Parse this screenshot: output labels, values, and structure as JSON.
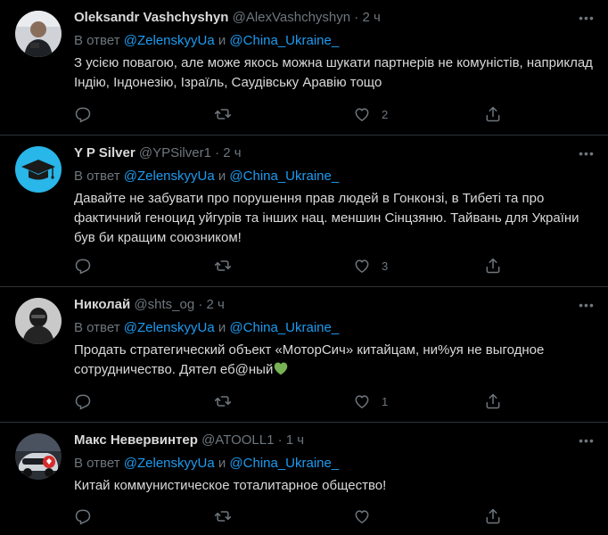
{
  "tweets": [
    {
      "name": "Oleksandr Vashchyshyn",
      "handle": "@AlexVashchyshyn",
      "dot": "·",
      "time": "2 ч",
      "reply_prefix": "В ответ",
      "reply_to_1": "@ZelenskyyUa",
      "reply_and": "и",
      "reply_to_2": "@China_Ukraine_",
      "text": "З усією повагою, але може якось можна шукати партнерів не комуністів, наприклад Індію, Індонезію, Ізраїль, Саудівську Аравію тощо",
      "likes": "2"
    },
    {
      "name": "Y P Silver",
      "handle": "@YPSilver1",
      "dot": "·",
      "time": "2 ч",
      "reply_prefix": "В ответ",
      "reply_to_1": "@ZelenskyyUa",
      "reply_and": "и",
      "reply_to_2": "@China_Ukraine_",
      "text": "Давайте не забувати про порушення прав людей в Гонконзі, в Тибеті та про фактичний геноцид уйгурів та інших нац. меншин Сінцзяню. Тайвань для України був би кращим союзником!",
      "likes": "3"
    },
    {
      "name": "Николай",
      "handle": "@shts_og",
      "dot": "·",
      "time": "2 ч",
      "reply_prefix": "В ответ",
      "reply_to_1": "@ZelenskyyUa",
      "reply_and": "и",
      "reply_to_2": "@China_Ukraine_",
      "text": "Продать стратегический объект «МоторСич» китайцам, ни%уя не выгодное сотрудничество. Дятел еб@ный",
      "likes": "1"
    },
    {
      "name": "Макс Невервинтер",
      "handle": "@ATOOLL1",
      "dot": "·",
      "time": "1 ч",
      "reply_prefix": "В ответ",
      "reply_to_1": "@ZelenskyyUa",
      "reply_and": "и",
      "reply_to_2": "@China_Ukraine_",
      "text": "Китай коммунистическое тоталитарное общество!",
      "likes": ""
    }
  ],
  "colors": {
    "background": "#000000",
    "link": "#1d9bf0",
    "muted": "#6e767d",
    "text": "#d9d9d9",
    "divider": "#2f3336",
    "green_heart": "#77b255"
  },
  "icons": {
    "reply": "reply-icon",
    "retweet": "retweet-icon",
    "like": "like-icon",
    "share": "share-icon",
    "more": "more-icon",
    "green_heart": "green-heart-emoji"
  }
}
